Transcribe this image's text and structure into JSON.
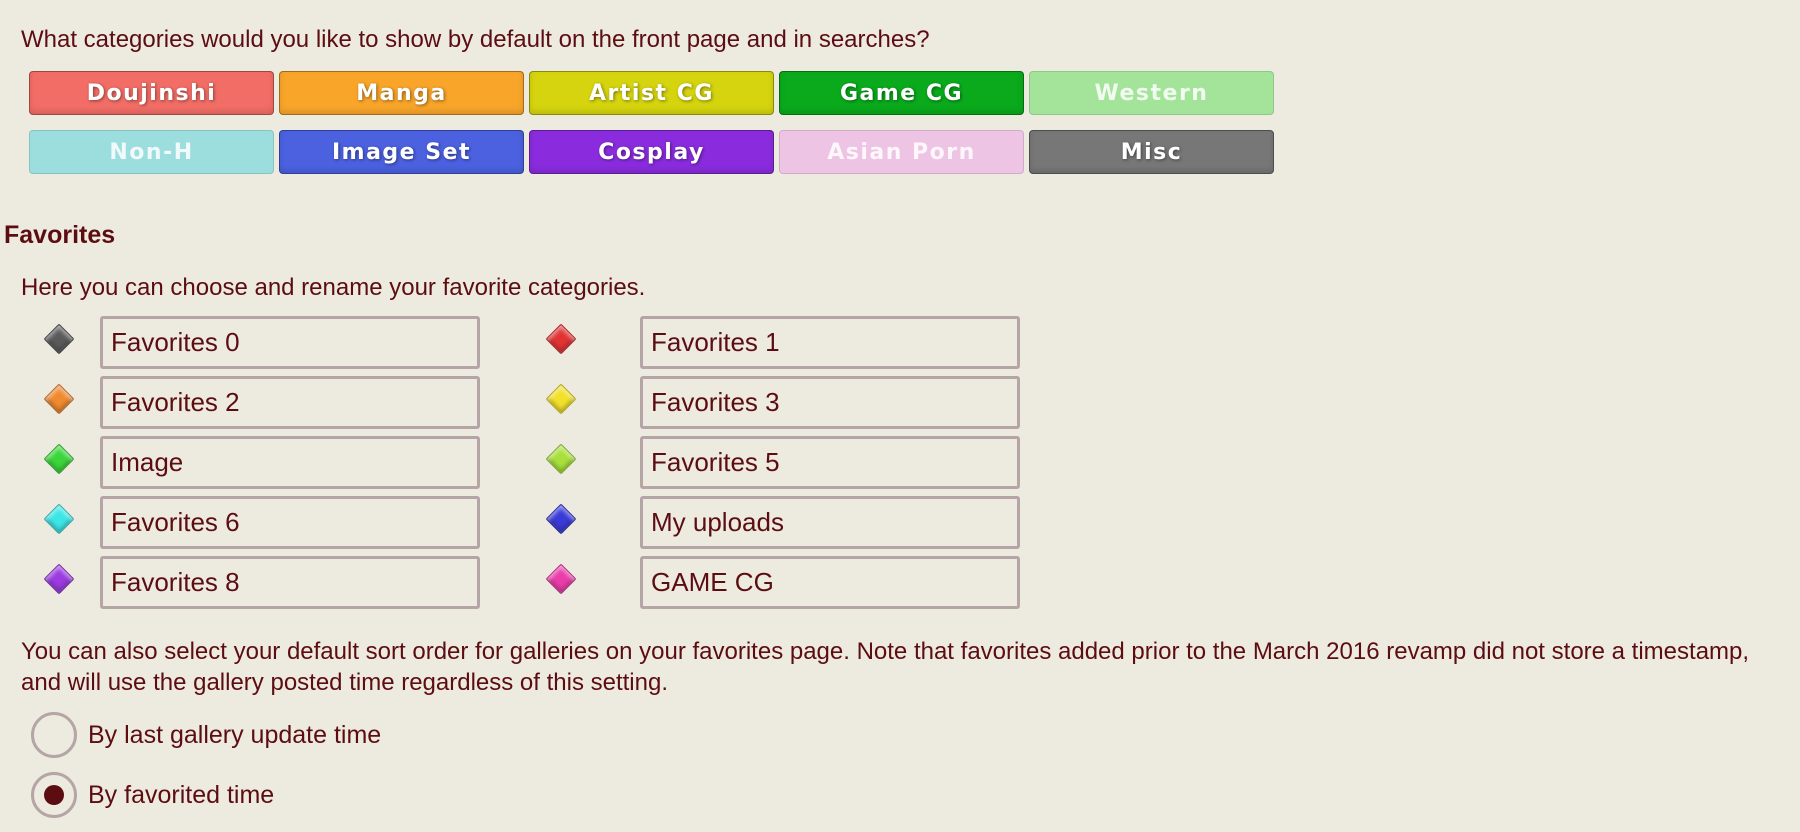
{
  "categories_question": "What categories would you like to show by default on the front page and in searches?",
  "categories": [
    {
      "label": "Doujinshi",
      "color": "#F26D66",
      "enabled": true
    },
    {
      "label": "Manga",
      "color": "#F8A52A",
      "enabled": true
    },
    {
      "label": "Artist CG",
      "color": "#D5D40E",
      "enabled": true
    },
    {
      "label": "Game CG",
      "color": "#0AAA1C",
      "enabled": true
    },
    {
      "label": "Western",
      "color": "#A3E39A",
      "enabled": false
    },
    {
      "label": "Non-H",
      "color": "#9CDDDE",
      "enabled": false
    },
    {
      "label": "Image Set",
      "color": "#4B61E0",
      "enabled": true
    },
    {
      "label": "Cosplay",
      "color": "#8A2CDE",
      "enabled": true
    },
    {
      "label": "Asian Porn",
      "color": "#EDC4E4",
      "enabled": false
    },
    {
      "label": "Misc",
      "color": "#777777",
      "enabled": true
    }
  ],
  "favorites": {
    "heading": "Favorites",
    "description": "Here you can choose and rename your favorite categories.",
    "slots": [
      {
        "value": "Favorites 0",
        "color": "#5A5A5A",
        "icon": "diamond-icon"
      },
      {
        "value": "Favorites 1",
        "color": "#E23333",
        "icon": "diamond-icon"
      },
      {
        "value": "Favorites 2",
        "color": "#F08A30",
        "icon": "diamond-icon"
      },
      {
        "value": "Favorites 3",
        "color": "#F2E12A",
        "icon": "diamond-icon"
      },
      {
        "value": "Image",
        "color": "#3BD63B",
        "icon": "diamond-icon"
      },
      {
        "value": "Favorites 5",
        "color": "#A8E03C",
        "icon": "diamond-icon"
      },
      {
        "value": "Favorites 6",
        "color": "#3CE6E6",
        "icon": "diamond-icon"
      },
      {
        "value": "My uploads",
        "color": "#3A3AD8",
        "icon": "diamond-icon"
      },
      {
        "value": "Favorites 8",
        "color": "#9B3BE0",
        "icon": "diamond-icon"
      },
      {
        "value": "GAME CG",
        "color": "#EA3DAA",
        "icon": "diamond-icon"
      }
    ]
  },
  "sort": {
    "description": "You can also select your default sort order for galleries on your favorites page. Note that favorites added prior to the March 2016 revamp did not store a timestamp, and will use the gallery posted time regardless of this setting.",
    "options": [
      {
        "label": "By last gallery update time",
        "selected": false
      },
      {
        "label": "By favorited time",
        "selected": true
      }
    ]
  }
}
